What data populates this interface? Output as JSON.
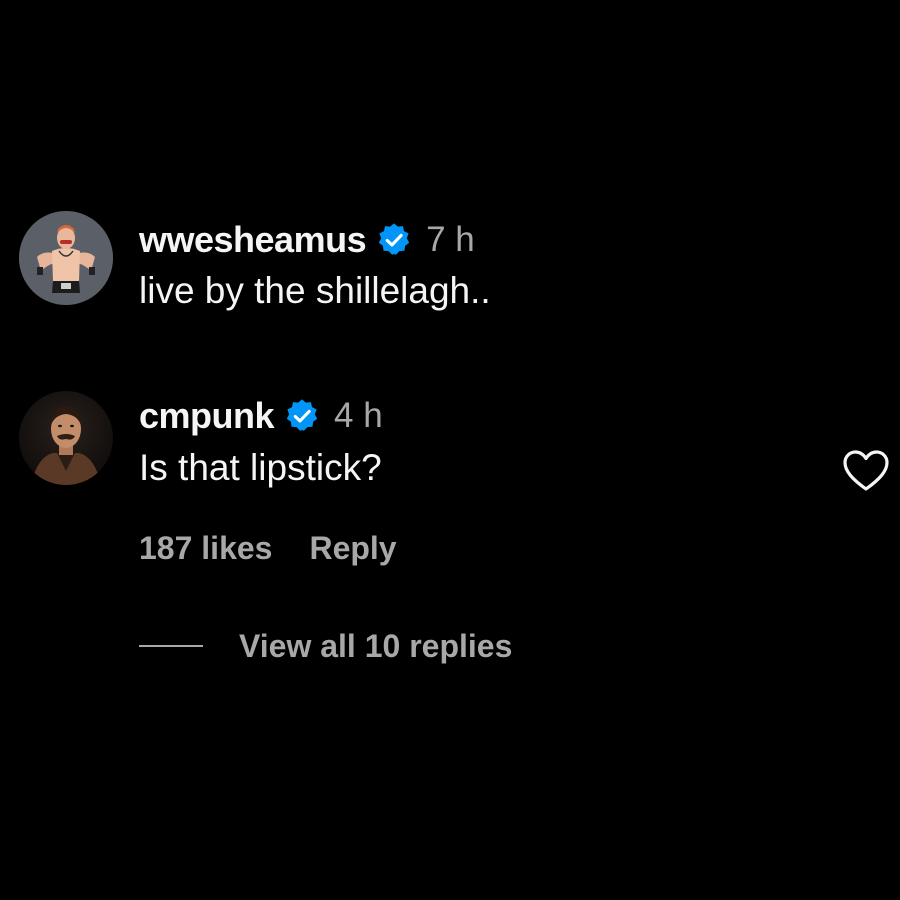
{
  "comments": [
    {
      "username": "wwesheamus",
      "verified": true,
      "time": "7 h",
      "text": "live by the shillelagh..",
      "avatar": "wrestler-avatar"
    },
    {
      "username": "cmpunk",
      "verified": true,
      "time": "4 h",
      "text": "Is that lipstick?",
      "avatar": "man-with-mustache-avatar",
      "likes": "187 likes",
      "reply_label": "Reply",
      "view_replies": "View all 10 replies"
    }
  ],
  "colors": {
    "background": "#000000",
    "primary_text": "#f5f5f5",
    "secondary_text": "#a8a8a8",
    "verified_blue": "#0095f6"
  },
  "icons": {
    "verified": "verified-badge-icon",
    "like": "heart-outline-icon"
  }
}
